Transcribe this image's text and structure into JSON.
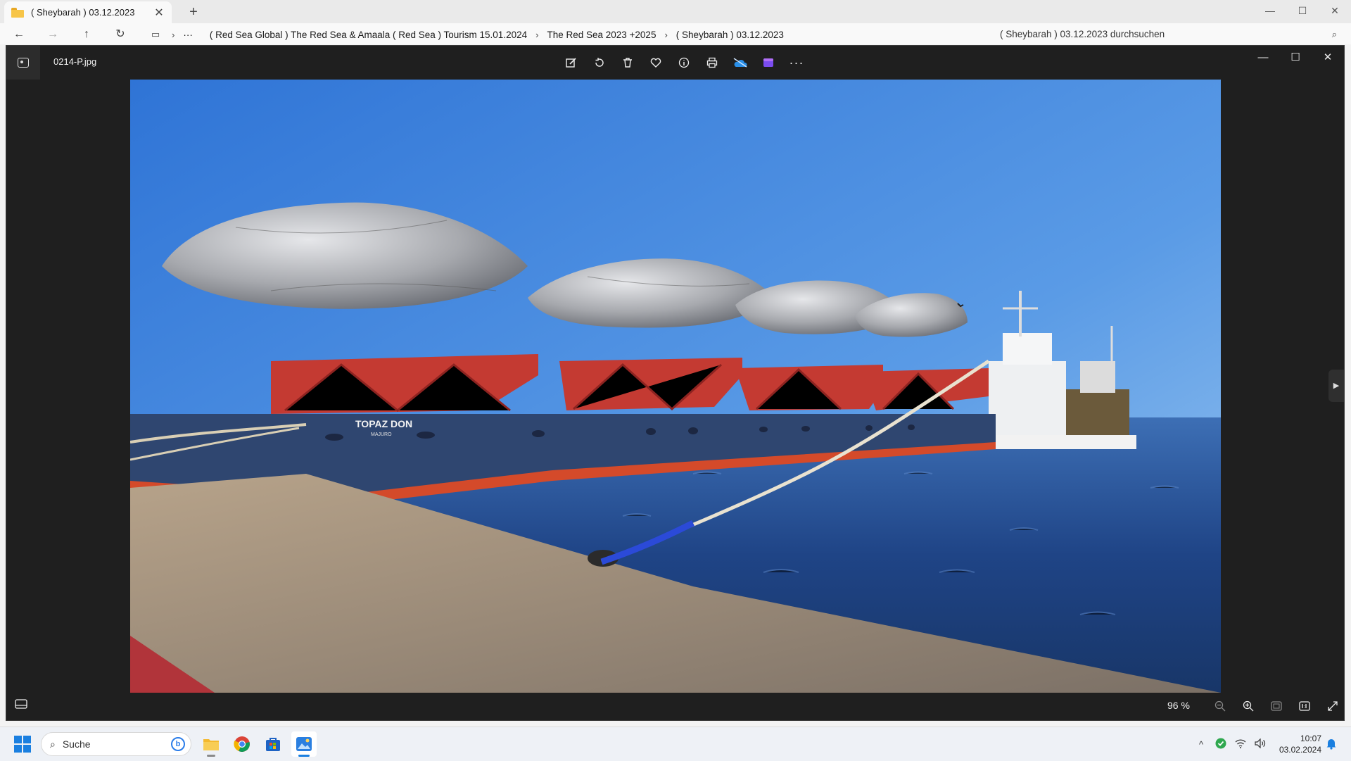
{
  "explorer": {
    "tab_title": "( Sheybarah ) 03.12.2023",
    "tab_close": "✕",
    "new_tab": "+",
    "window_controls": {
      "minimize": "—",
      "maximize": "☐",
      "close": "✕"
    },
    "breadcrumb": [
      "( Red Sea Global ) The Red Sea & Amaala ( Red Sea ) Tourism 15.01.2024",
      "The Red Sea 2023 +2025",
      "( Sheybarah ) 03.12.2023"
    ],
    "breadcrumb_overflow": "···",
    "search_placeholder": "( Sheybarah ) 03.12.2023 durchsuchen"
  },
  "viewer": {
    "file_name": "0214-P.jpg",
    "toolbar_icons": [
      "edit-icon",
      "rotate-icon",
      "delete-icon",
      "favorite-icon",
      "info-icon",
      "print-icon",
      "onedrive-icon",
      "clipchamp-icon",
      "more-icon"
    ],
    "more_label": "···",
    "window_controls": {
      "minimize": "—",
      "maximize": "☐",
      "close": "✕"
    },
    "next_arrow": "▶",
    "zoom_level": "96 %",
    "photo": {
      "ship_name": "TOPAZ DON",
      "ship_port": "MAJURO"
    }
  },
  "taskbar": {
    "search_label": "Suche",
    "bing_label": "b",
    "time": "10:07",
    "date": "03.02.2024",
    "tray_up": "^"
  },
  "colors": {
    "accent": "#1a7fe0",
    "viewer_bg": "#1f1f1f",
    "sky_top": "#2f75d4",
    "sea": "#1d3f7a"
  }
}
